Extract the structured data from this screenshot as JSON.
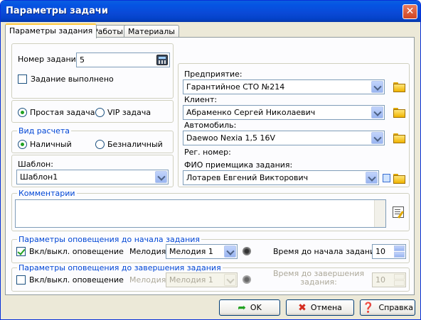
{
  "window": {
    "title": "Параметры задачи",
    "close_glyph": "✕"
  },
  "tabs": [
    {
      "label": "Параметры задания"
    },
    {
      "label": "Работы"
    },
    {
      "label": "Материалы"
    }
  ],
  "task": {
    "number_label": "Номер задания:",
    "number_value": "5",
    "done_label": "Задание выполнено",
    "simple_label": "Простая задача",
    "vip_label": "VIP задача"
  },
  "payment": {
    "group_label": "Вид расчета",
    "cash_label": "Наличный",
    "noncash_label": "Безналичный"
  },
  "template": {
    "label": "Шаблон:",
    "value": "Шаблон1"
  },
  "right": {
    "enterprise_label": "Предприятие:",
    "enterprise_value": "Гарантийное СТО №214",
    "client_label": "Клиент:",
    "client_value": "Абраменко Сергей Николаевич",
    "car_label": "Автомобиль:",
    "car_value": "Daewoo Nexia 1,5 16V",
    "reg_label": "Рег. номер:",
    "receiver_label": "ФИО приемщика задания:",
    "receiver_value": "Лотарев Евгений Викторович"
  },
  "comments": {
    "group_label": "Комментарии",
    "value": ""
  },
  "notify_start": {
    "group_label": "Параметры оповещения до начала задания",
    "toggle_label": "Вкл/выкл. оповещение",
    "melody_label": "Мелодия:",
    "melody_value": "Мелодия 1",
    "time_label": "Время до начала задания:",
    "time_value": "10"
  },
  "notify_end": {
    "group_label": "Параметры оповещения до завершения задания",
    "toggle_label": "Вкл/выкл. оповещение",
    "melody_label": "Мелодия:",
    "melody_value": "Мелодия 1",
    "time_label_1": "Время до завершения",
    "time_label_2": "задания:",
    "time_value": "10"
  },
  "buttons": {
    "ok_label": "OK",
    "cancel_label": "Отмена",
    "help_label": "Справка"
  },
  "colors": {
    "title_bar": "#0a49d6",
    "group_label": "#0046d5",
    "ok_icon": "#21a121",
    "cancel_icon": "#d42b1e",
    "help_icon": "#3a6fd1"
  },
  "icons": [
    "close-icon",
    "calculator-icon",
    "folder-open-icon",
    "note-icon",
    "speaker-icon",
    "edit-note-icon",
    "ok-arrow-icon",
    "cancel-x-icon",
    "help-icon"
  ]
}
